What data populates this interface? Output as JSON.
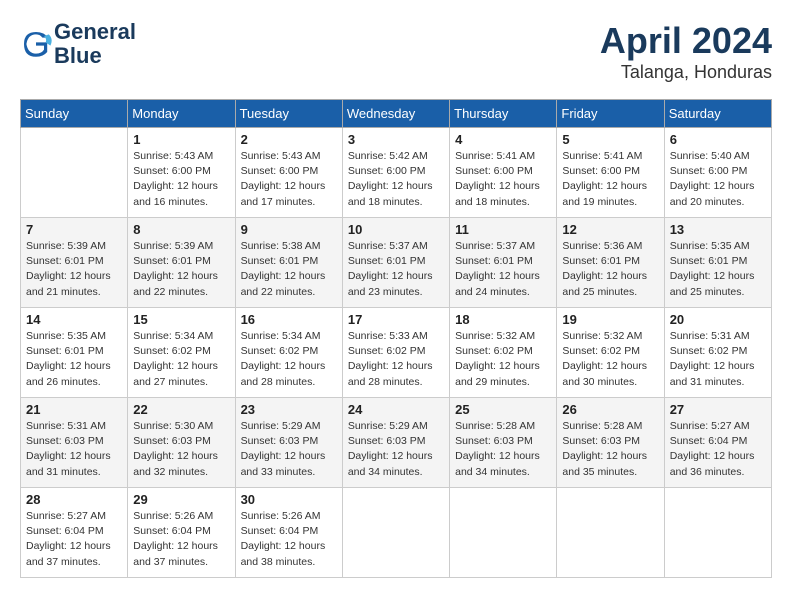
{
  "header": {
    "logo_line1": "General",
    "logo_line2": "Blue",
    "month": "April 2024",
    "location": "Talanga, Honduras"
  },
  "days_of_week": [
    "Sunday",
    "Monday",
    "Tuesday",
    "Wednesday",
    "Thursday",
    "Friday",
    "Saturday"
  ],
  "weeks": [
    [
      {
        "num": "",
        "info": ""
      },
      {
        "num": "1",
        "info": "Sunrise: 5:43 AM\nSunset: 6:00 PM\nDaylight: 12 hours\nand 16 minutes."
      },
      {
        "num": "2",
        "info": "Sunrise: 5:43 AM\nSunset: 6:00 PM\nDaylight: 12 hours\nand 17 minutes."
      },
      {
        "num": "3",
        "info": "Sunrise: 5:42 AM\nSunset: 6:00 PM\nDaylight: 12 hours\nand 18 minutes."
      },
      {
        "num": "4",
        "info": "Sunrise: 5:41 AM\nSunset: 6:00 PM\nDaylight: 12 hours\nand 18 minutes."
      },
      {
        "num": "5",
        "info": "Sunrise: 5:41 AM\nSunset: 6:00 PM\nDaylight: 12 hours\nand 19 minutes."
      },
      {
        "num": "6",
        "info": "Sunrise: 5:40 AM\nSunset: 6:00 PM\nDaylight: 12 hours\nand 20 minutes."
      }
    ],
    [
      {
        "num": "7",
        "info": "Sunrise: 5:39 AM\nSunset: 6:01 PM\nDaylight: 12 hours\nand 21 minutes."
      },
      {
        "num": "8",
        "info": "Sunrise: 5:39 AM\nSunset: 6:01 PM\nDaylight: 12 hours\nand 22 minutes."
      },
      {
        "num": "9",
        "info": "Sunrise: 5:38 AM\nSunset: 6:01 PM\nDaylight: 12 hours\nand 22 minutes."
      },
      {
        "num": "10",
        "info": "Sunrise: 5:37 AM\nSunset: 6:01 PM\nDaylight: 12 hours\nand 23 minutes."
      },
      {
        "num": "11",
        "info": "Sunrise: 5:37 AM\nSunset: 6:01 PM\nDaylight: 12 hours\nand 24 minutes."
      },
      {
        "num": "12",
        "info": "Sunrise: 5:36 AM\nSunset: 6:01 PM\nDaylight: 12 hours\nand 25 minutes."
      },
      {
        "num": "13",
        "info": "Sunrise: 5:35 AM\nSunset: 6:01 PM\nDaylight: 12 hours\nand 25 minutes."
      }
    ],
    [
      {
        "num": "14",
        "info": "Sunrise: 5:35 AM\nSunset: 6:01 PM\nDaylight: 12 hours\nand 26 minutes."
      },
      {
        "num": "15",
        "info": "Sunrise: 5:34 AM\nSunset: 6:02 PM\nDaylight: 12 hours\nand 27 minutes."
      },
      {
        "num": "16",
        "info": "Sunrise: 5:34 AM\nSunset: 6:02 PM\nDaylight: 12 hours\nand 28 minutes."
      },
      {
        "num": "17",
        "info": "Sunrise: 5:33 AM\nSunset: 6:02 PM\nDaylight: 12 hours\nand 28 minutes."
      },
      {
        "num": "18",
        "info": "Sunrise: 5:32 AM\nSunset: 6:02 PM\nDaylight: 12 hours\nand 29 minutes."
      },
      {
        "num": "19",
        "info": "Sunrise: 5:32 AM\nSunset: 6:02 PM\nDaylight: 12 hours\nand 30 minutes."
      },
      {
        "num": "20",
        "info": "Sunrise: 5:31 AM\nSunset: 6:02 PM\nDaylight: 12 hours\nand 31 minutes."
      }
    ],
    [
      {
        "num": "21",
        "info": "Sunrise: 5:31 AM\nSunset: 6:03 PM\nDaylight: 12 hours\nand 31 minutes."
      },
      {
        "num": "22",
        "info": "Sunrise: 5:30 AM\nSunset: 6:03 PM\nDaylight: 12 hours\nand 32 minutes."
      },
      {
        "num": "23",
        "info": "Sunrise: 5:29 AM\nSunset: 6:03 PM\nDaylight: 12 hours\nand 33 minutes."
      },
      {
        "num": "24",
        "info": "Sunrise: 5:29 AM\nSunset: 6:03 PM\nDaylight: 12 hours\nand 34 minutes."
      },
      {
        "num": "25",
        "info": "Sunrise: 5:28 AM\nSunset: 6:03 PM\nDaylight: 12 hours\nand 34 minutes."
      },
      {
        "num": "26",
        "info": "Sunrise: 5:28 AM\nSunset: 6:03 PM\nDaylight: 12 hours\nand 35 minutes."
      },
      {
        "num": "27",
        "info": "Sunrise: 5:27 AM\nSunset: 6:04 PM\nDaylight: 12 hours\nand 36 minutes."
      }
    ],
    [
      {
        "num": "28",
        "info": "Sunrise: 5:27 AM\nSunset: 6:04 PM\nDaylight: 12 hours\nand 37 minutes."
      },
      {
        "num": "29",
        "info": "Sunrise: 5:26 AM\nSunset: 6:04 PM\nDaylight: 12 hours\nand 37 minutes."
      },
      {
        "num": "30",
        "info": "Sunrise: 5:26 AM\nSunset: 6:04 PM\nDaylight: 12 hours\nand 38 minutes."
      },
      {
        "num": "",
        "info": ""
      },
      {
        "num": "",
        "info": ""
      },
      {
        "num": "",
        "info": ""
      },
      {
        "num": "",
        "info": ""
      }
    ]
  ]
}
